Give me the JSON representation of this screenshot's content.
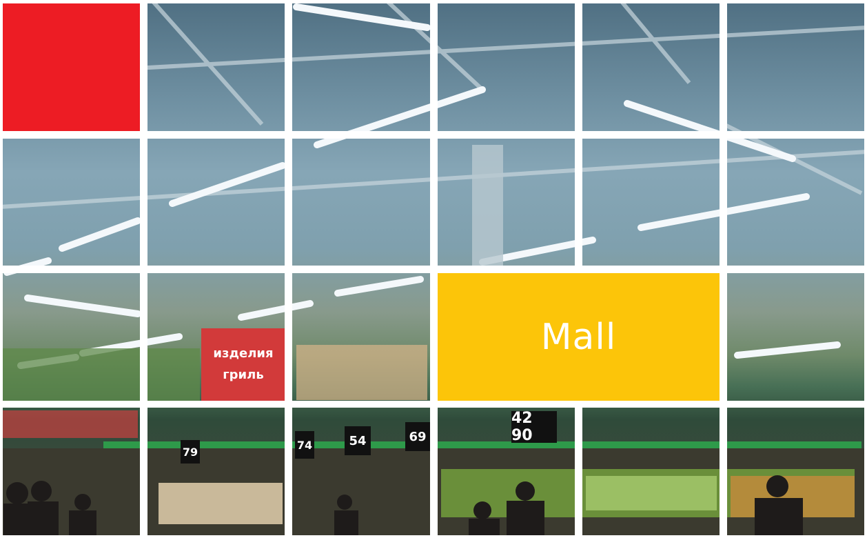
{
  "image": {
    "tile_label": "Mall",
    "store_sign_line1": "изделия",
    "store_sign_line2": "гриль",
    "price_tags": [
      "79",
      "74",
      "54",
      "69",
      "42 90"
    ],
    "colors": {
      "red_tile": "#ed1c24",
      "yellow_tile": "#fcc509",
      "grid_lines": "#ffffff"
    }
  }
}
